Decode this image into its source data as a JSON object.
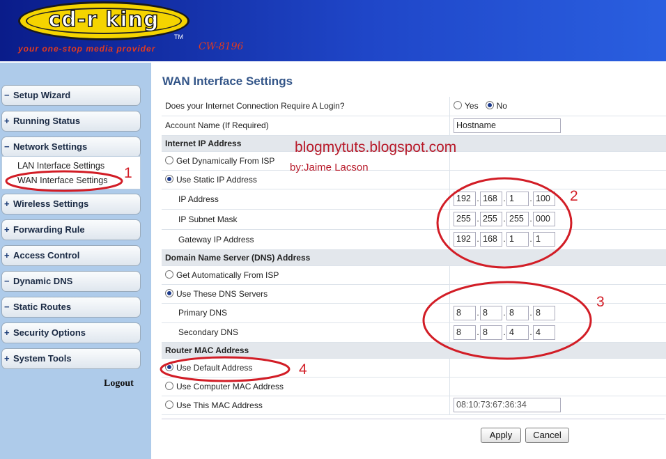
{
  "header": {
    "logo_text": "cd-r king",
    "trademark": "TM",
    "tagline": "your one-stop media provider",
    "model": "CW-8196"
  },
  "sidebar": {
    "items": [
      {
        "label": "Setup Wizard",
        "icon": "minus"
      },
      {
        "label": "Running Status",
        "icon": "plus"
      },
      {
        "label": "Network Settings",
        "icon": "minus"
      },
      {
        "label": "Wireless Settings",
        "icon": "plus"
      },
      {
        "label": "Forwarding Rule",
        "icon": "plus"
      },
      {
        "label": "Access Control",
        "icon": "plus"
      },
      {
        "label": "Dynamic DNS",
        "icon": "minus"
      },
      {
        "label": "Static Routes",
        "icon": "minus"
      },
      {
        "label": "Security Options",
        "icon": "plus"
      },
      {
        "label": "System Tools",
        "icon": "plus"
      }
    ],
    "submenu": [
      "LAN Interface Settings",
      "WAN Interface Settings"
    ],
    "logout": "Logout"
  },
  "page": {
    "title": "WAN Interface Settings",
    "login_question": "Does your Internet Connection Require A Login?",
    "login_yes": "Yes",
    "login_no": "No",
    "account_label": "Account Name (If Required)",
    "account_value": "Hostname",
    "ip_section": "Internet IP Address",
    "dynamic_ip": "Get Dynamically From ISP",
    "static_ip": "Use Static IP Address",
    "ip_label": "IP Address",
    "subnet_label": "IP Subnet Mask",
    "gateway_label": "Gateway IP Address",
    "ip": [
      "192",
      "168",
      "1",
      "100"
    ],
    "subnet": [
      "255",
      "255",
      "255",
      "000"
    ],
    "gateway": [
      "192",
      "168",
      "1",
      "1"
    ],
    "dns_section": "Domain Name Server (DNS) Address",
    "dns_auto": "Get Automatically From ISP",
    "dns_manual": "Use These DNS Servers",
    "primary_dns_label": "Primary DNS",
    "secondary_dns_label": "Secondary DNS",
    "primary_dns": [
      "8",
      "8",
      "8",
      "8"
    ],
    "secondary_dns": [
      "8",
      "8",
      "4",
      "4"
    ],
    "mac_section": "Router MAC Address",
    "mac_default": "Use Default Address",
    "mac_computer": "Use Computer MAC Address",
    "mac_this": "Use This MAC Address",
    "mac_value": "08:10:73:67:36:34",
    "apply": "Apply",
    "cancel": "Cancel"
  },
  "annotations": {
    "blog": "blogmytuts.blogspot.com",
    "author": "by:Jaime Lacson",
    "num1": "1",
    "num2": "2",
    "num3": "3",
    "num4": "4",
    "color": "#d21d26"
  }
}
